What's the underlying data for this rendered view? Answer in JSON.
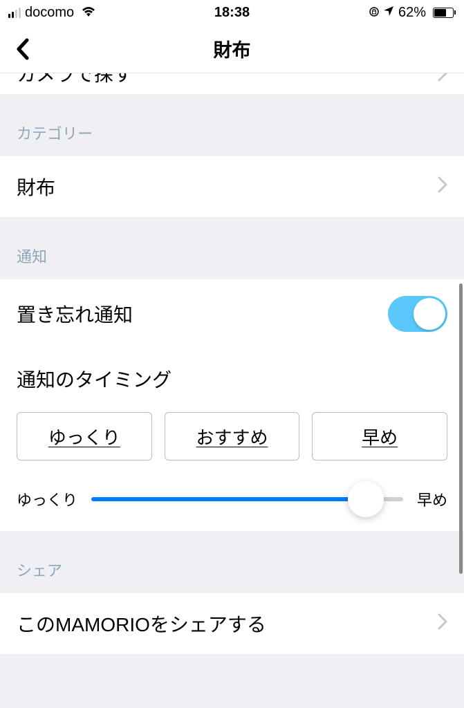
{
  "status": {
    "carrier": "docomo",
    "time": "18:38",
    "battery_pct": "62%"
  },
  "nav": {
    "title": "財布"
  },
  "cut_row": {
    "text": "カメラで探す"
  },
  "category": {
    "header": "カテゴリー",
    "value": "財布"
  },
  "notification": {
    "header": "通知",
    "forget_label": "置き忘れ通知",
    "timing_label": "通知のタイミング",
    "options": {
      "slow": "ゆっくり",
      "recommended": "おすすめ",
      "fast": "早め"
    },
    "slider_left": "ゆっくり",
    "slider_right": "早め"
  },
  "share": {
    "header": "シェア",
    "label": "このMAMORIOをシェアする"
  }
}
